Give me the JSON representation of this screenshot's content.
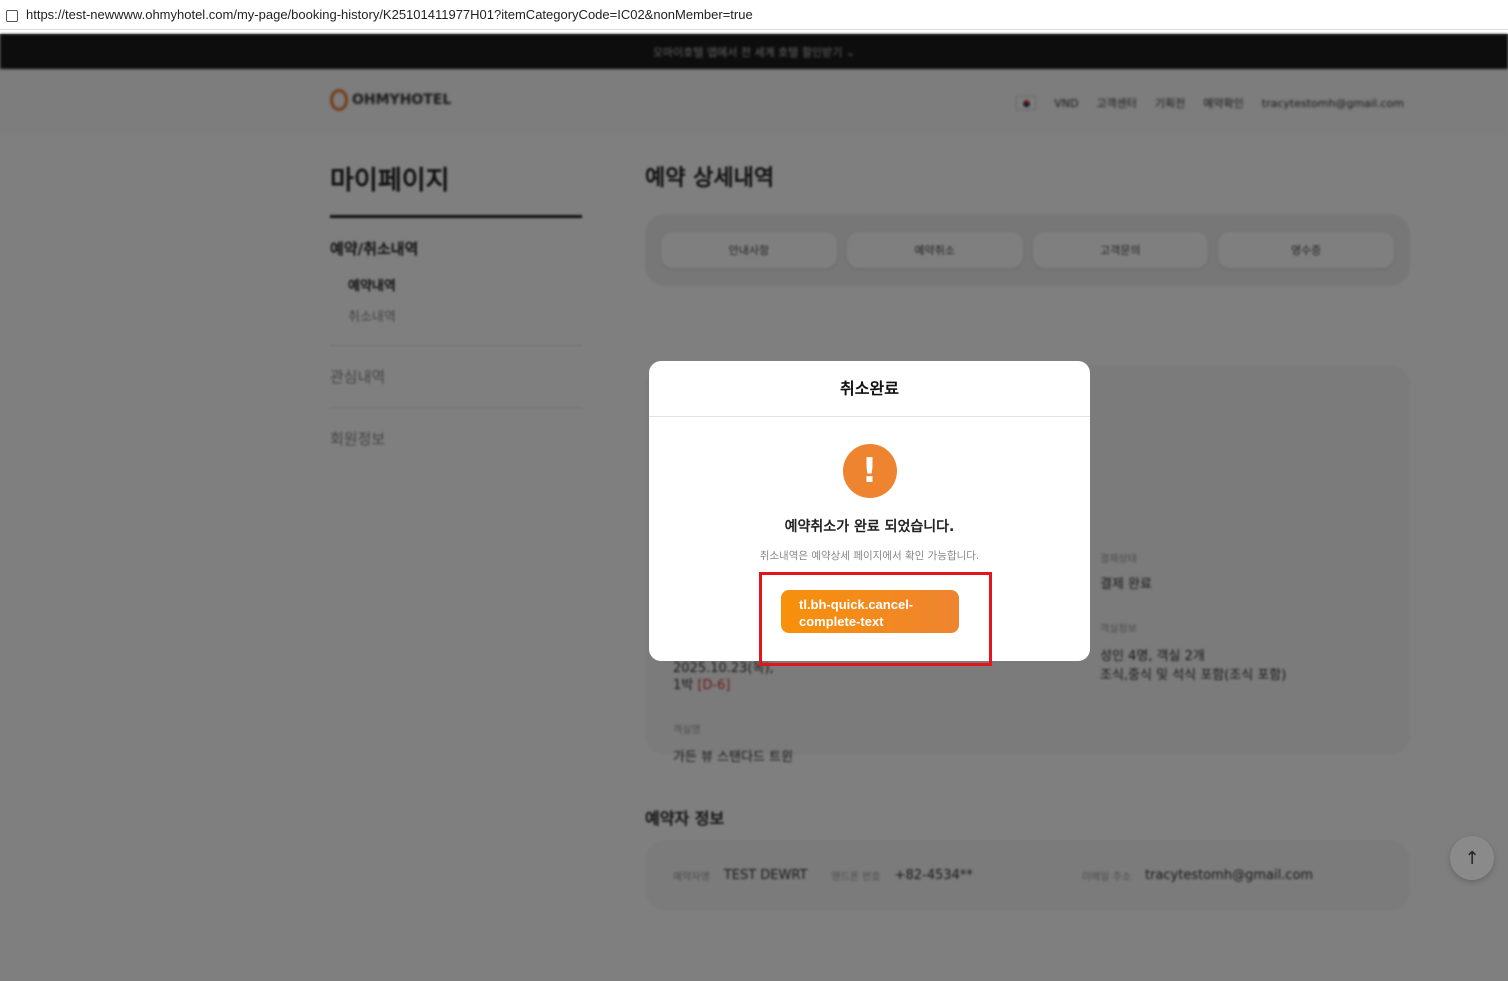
{
  "browser": {
    "url": "https://test-newwww.ohmyhotel.com/my-page/booking-history/K25101411977H01?itemCategoryCode=IC02&nonMember=true"
  },
  "banner": {
    "text": "오마이호텔 앱에서 전 세계 호텔 할인받기 ⌄"
  },
  "header": {
    "logo": "OHMYHOTEL",
    "currency": "VND",
    "nav": [
      "고객센터",
      "기획전",
      "예약확인"
    ],
    "user_email": "tracytestomh@gmail.com"
  },
  "sidebar": {
    "title": "마이페이지",
    "group": "예약/취소내역",
    "subs": [
      "예약내역",
      "취소내역"
    ],
    "items": [
      "관심내역",
      "회원정보"
    ]
  },
  "main": {
    "title": "예약 상세내역",
    "tabs": [
      "안내사항",
      "예약취소",
      "고객문의",
      "영수증"
    ],
    "card": {
      "payment_label": "결제상태",
      "payment_value": "결제 완료",
      "room_info_label": "객실정보",
      "room_info_1": "성인 4명, 객실 2개",
      "room_info_2": "조식,중식 및 석식 포함(조식 포함)",
      "date": "2025.10.23(목),",
      "nights": "1박",
      "dday": "[D-6]",
      "room_name_label": "객실명",
      "room_name": "가든 뷰 스탠다드 트윈"
    }
  },
  "booker": {
    "title": "예약자 정보",
    "name_label": "예약자명",
    "name": "TEST DEWRT",
    "phone_label": "핸드폰 번호",
    "phone": "+82-4534**",
    "email_label": "이메일 주소",
    "email": "tracytestomh@gmail.com"
  },
  "modal": {
    "title": "취소완료",
    "icon": "!",
    "message": "예약취소가 완료 되었습니다.",
    "submessage": "취소내역은 예약상세 페이지에서 확인 가능합니다.",
    "button": "tl.bh-quick.cancel-complete-text"
  },
  "colors": {
    "accent": "#ef8430",
    "highlight": "#e3141c"
  }
}
